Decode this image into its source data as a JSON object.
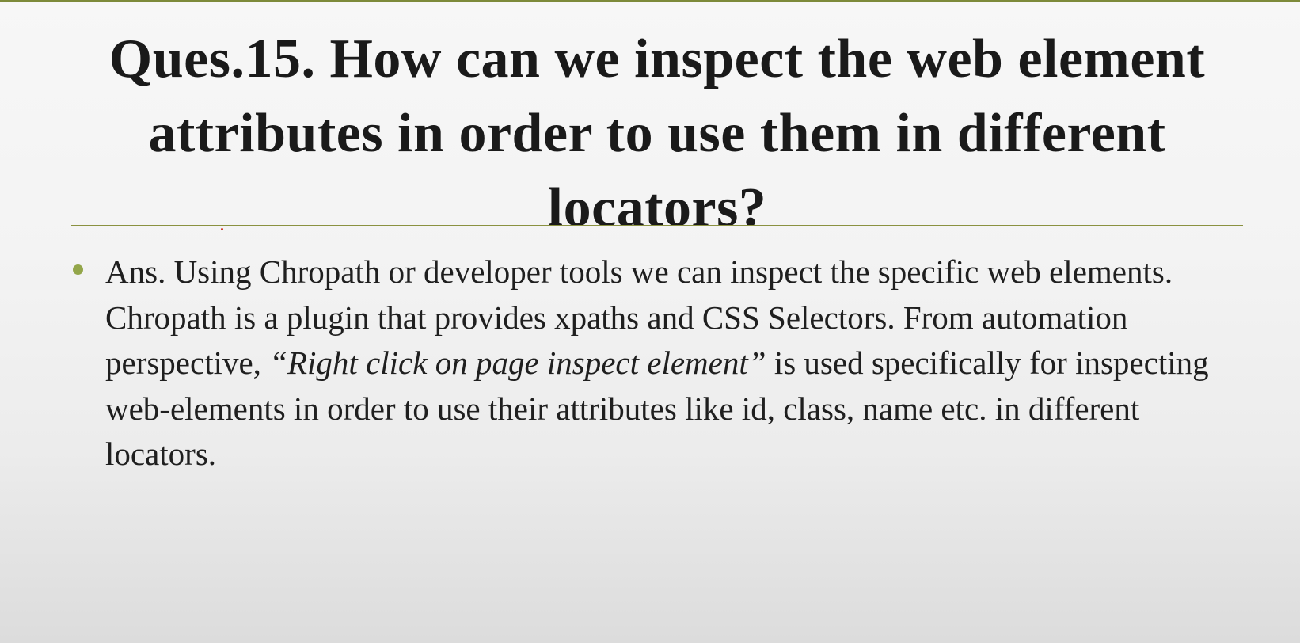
{
  "slide": {
    "title": "Ques.15. How can we inspect the web element attributes in order to use them in different locators?",
    "answer": {
      "line1": "Ans. Using Chropath or developer tools we can inspect the specific web elements.",
      "line2_before": "Chropath is a plugin that provides xpaths and CSS Selectors. From automation perspective, ",
      "line2_quote": "“Right click on page inspect element”",
      "line2_after": " is used specifically for inspecting web-elements in order to use their attributes like id, class, name etc. in different locators."
    }
  },
  "colors": {
    "accent_rule": "#8a9140",
    "bullet": "#93a64a",
    "text": "#1f1f1f"
  }
}
